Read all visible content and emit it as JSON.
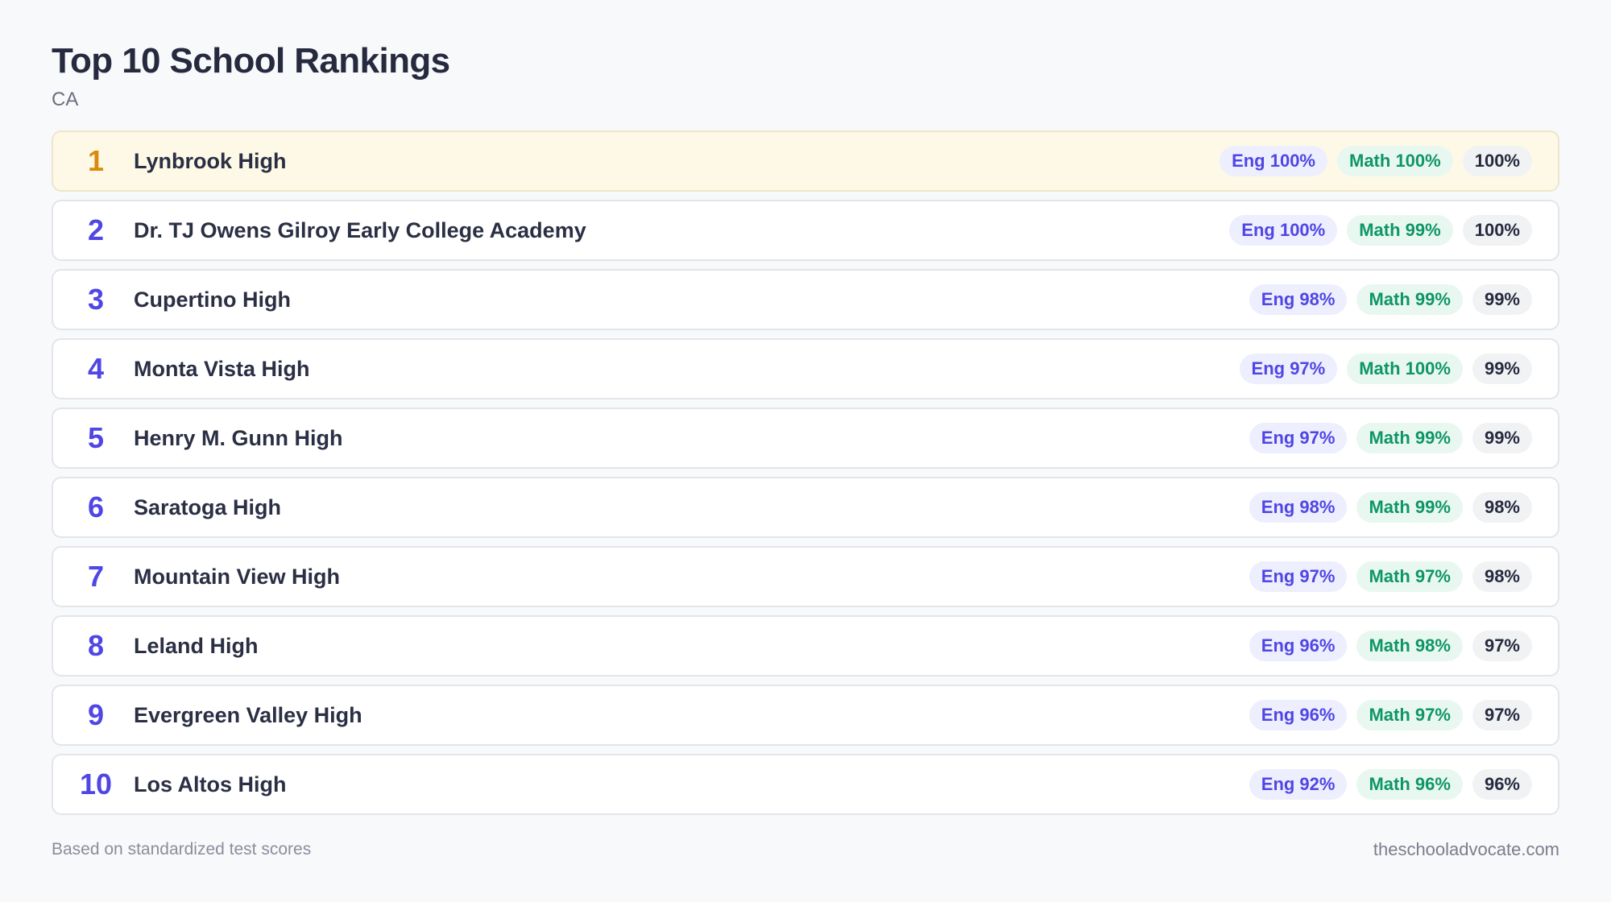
{
  "header": {
    "title": "Top 10 School Rankings",
    "subtitle": "CA"
  },
  "schools": [
    {
      "rank": "1",
      "name": "Lynbrook High",
      "eng": "Eng 100%",
      "math": "Math 100%",
      "total": "100%"
    },
    {
      "rank": "2",
      "name": "Dr. TJ Owens Gilroy Early College Academy",
      "eng": "Eng 100%",
      "math": "Math 99%",
      "total": "100%"
    },
    {
      "rank": "3",
      "name": "Cupertino High",
      "eng": "Eng 98%",
      "math": "Math 99%",
      "total": "99%"
    },
    {
      "rank": "4",
      "name": "Monta Vista High",
      "eng": "Eng 97%",
      "math": "Math 100%",
      "total": "99%"
    },
    {
      "rank": "5",
      "name": "Henry M. Gunn High",
      "eng": "Eng 97%",
      "math": "Math 99%",
      "total": "99%"
    },
    {
      "rank": "6",
      "name": "Saratoga High",
      "eng": "Eng 98%",
      "math": "Math 99%",
      "total": "98%"
    },
    {
      "rank": "7",
      "name": "Mountain View High",
      "eng": "Eng 97%",
      "math": "Math 97%",
      "total": "98%"
    },
    {
      "rank": "8",
      "name": "Leland High",
      "eng": "Eng 96%",
      "math": "Math 98%",
      "total": "97%"
    },
    {
      "rank": "9",
      "name": "Evergreen Valley High",
      "eng": "Eng 96%",
      "math": "Math 97%",
      "total": "97%"
    },
    {
      "rank": "10",
      "name": "Los Altos High",
      "eng": "Eng 92%",
      "math": "Math 96%",
      "total": "96%"
    }
  ],
  "footer": {
    "note": "Based on standardized test scores",
    "source": "theschooladvocate.com"
  },
  "colors": {
    "accent": "#4f46e5",
    "top_rank": "#d98b0b",
    "math": "#0f9666",
    "top_row_bg": "#fef9e6"
  }
}
